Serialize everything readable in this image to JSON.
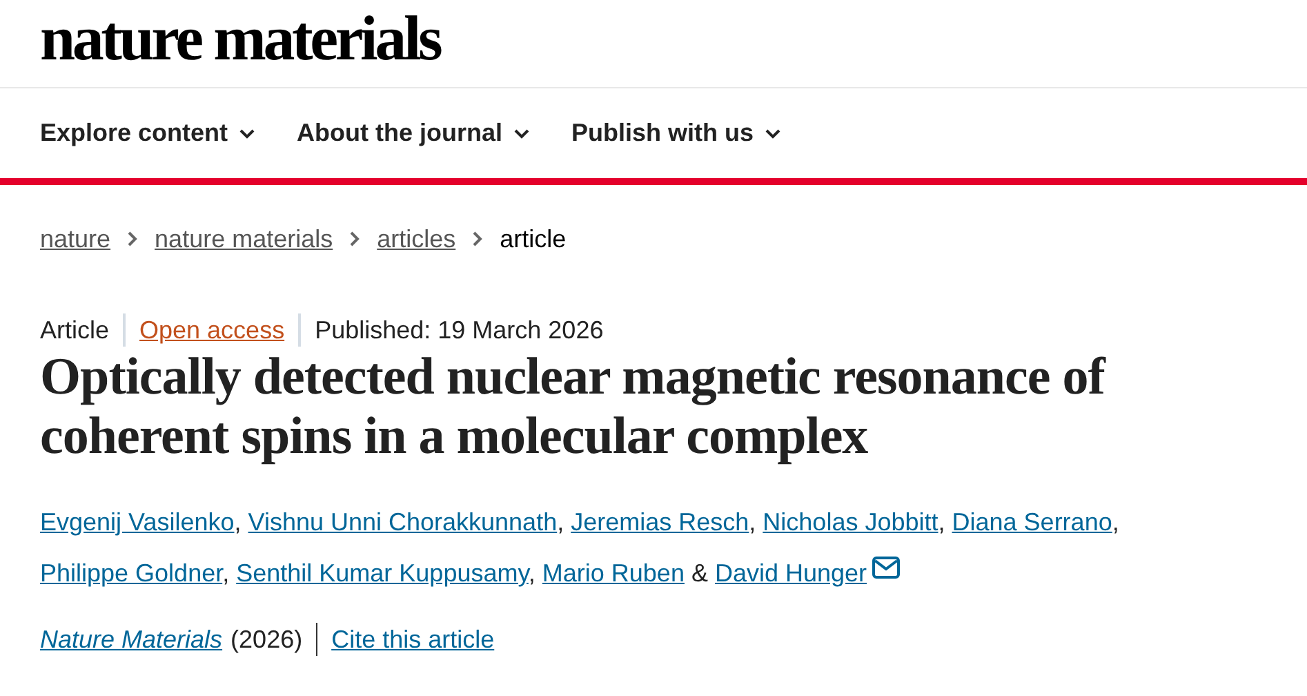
{
  "logo": "nature materials",
  "nav": [
    {
      "label": "Explore content",
      "dropdown": true
    },
    {
      "label": "About the journal",
      "dropdown": true
    },
    {
      "label": "Publish with us",
      "dropdown": true
    }
  ],
  "breadcrumbs": [
    {
      "label": "nature",
      "link": true
    },
    {
      "label": "nature materials",
      "link": true
    },
    {
      "label": "articles",
      "link": true
    },
    {
      "label": "article",
      "link": false
    }
  ],
  "meta": {
    "type": "Article",
    "access": "Open access",
    "published": "Published: 19 March 2026"
  },
  "title": "Optically detected nuclear magnetic resonance of coherent spins in a molecular complex",
  "authors": [
    {
      "name": "Evgenij Vasilenko",
      "separator": ","
    },
    {
      "name": "Vishnu Unni Chorakkunnath",
      "separator": ","
    },
    {
      "name": "Jeremias Resch",
      "separator": ","
    },
    {
      "name": "Nicholas Jobbitt",
      "separator": ","
    },
    {
      "name": "Diana Serrano",
      "separator": ","
    },
    {
      "name": "Philippe Goldner",
      "separator": ","
    },
    {
      "name": "Senthil Kumar Kuppusamy",
      "separator": ","
    },
    {
      "name": "Mario Ruben",
      "separator": "&"
    },
    {
      "name": "David Hunger",
      "corresponding": true
    }
  ],
  "citation": {
    "journal": "Nature Materials",
    "year": "(2026)",
    "cite": "Cite this article"
  }
}
